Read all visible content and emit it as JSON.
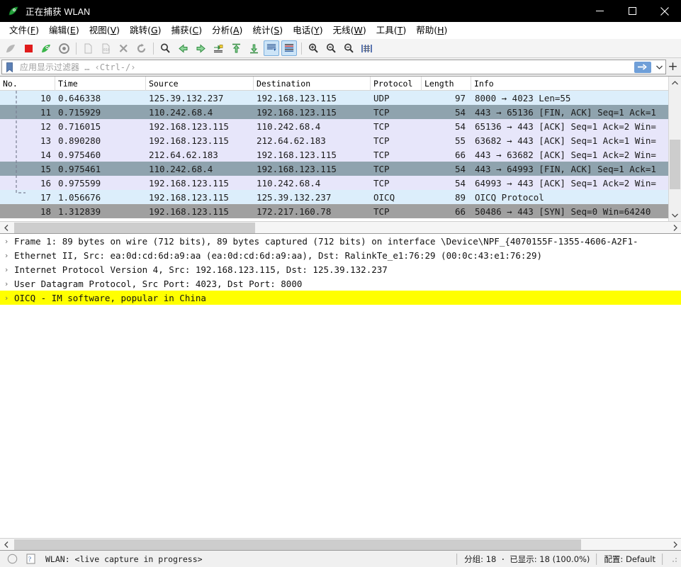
{
  "window": {
    "title": "正在捕获 WLAN",
    "app_icon": "wireshark-fin-icon",
    "controls": [
      {
        "name": "minimize-button",
        "glyph": "minimize-icon"
      },
      {
        "name": "maximize-button",
        "glyph": "maximize-icon"
      },
      {
        "name": "close-button",
        "glyph": "close-icon"
      }
    ]
  },
  "menubar": {
    "items": [
      {
        "label": "文件",
        "accel": "F"
      },
      {
        "label": "编辑",
        "accel": "E"
      },
      {
        "label": "视图",
        "accel": "V"
      },
      {
        "label": "跳转",
        "accel": "G"
      },
      {
        "label": "捕获",
        "accel": "C"
      },
      {
        "label": "分析",
        "accel": "A"
      },
      {
        "label": "统计",
        "accel": "S"
      },
      {
        "label": "电话",
        "accel": "Y"
      },
      {
        "label": "无线",
        "accel": "W"
      },
      {
        "label": "工具",
        "accel": "T"
      },
      {
        "label": "帮助",
        "accel": "H"
      }
    ]
  },
  "toolbar": {
    "buttons": [
      {
        "name": "start-capture-icon",
        "enabled": false,
        "active": false
      },
      {
        "name": "stop-capture-icon",
        "enabled": true,
        "active": false
      },
      {
        "name": "restart-capture-icon",
        "enabled": true,
        "active": false
      },
      {
        "name": "capture-options-icon",
        "enabled": true,
        "active": false
      },
      {
        "sep": true
      },
      {
        "name": "open-file-icon",
        "enabled": false,
        "active": false
      },
      {
        "name": "save-file-icon",
        "enabled": false,
        "active": false
      },
      {
        "name": "close-file-icon",
        "enabled": false,
        "active": false
      },
      {
        "name": "reload-file-icon",
        "enabled": false,
        "active": false
      },
      {
        "sep": true
      },
      {
        "name": "find-packet-icon",
        "enabled": true,
        "active": false
      },
      {
        "name": "go-back-icon",
        "enabled": true,
        "active": false
      },
      {
        "name": "go-forward-icon",
        "enabled": true,
        "active": false
      },
      {
        "name": "go-to-packet-icon",
        "enabled": true,
        "active": false
      },
      {
        "name": "go-to-first-packet-icon",
        "enabled": true,
        "active": false
      },
      {
        "name": "go-to-last-packet-icon",
        "enabled": true,
        "active": false
      },
      {
        "name": "auto-scroll-icon",
        "enabled": true,
        "active": true
      },
      {
        "name": "colorize-packets-icon",
        "enabled": true,
        "active": true
      },
      {
        "sep2": true
      },
      {
        "name": "zoom-in-icon",
        "enabled": true,
        "active": false
      },
      {
        "name": "zoom-out-icon",
        "enabled": true,
        "active": false
      },
      {
        "name": "zoom-reset-icon",
        "enabled": true,
        "active": false
      },
      {
        "name": "resize-columns-icon",
        "enabled": true,
        "active": false
      }
    ]
  },
  "filter": {
    "bookmark_icon": "filter-bookmark-icon",
    "value": "",
    "placeholder": "应用显示过滤器 … ‹Ctrl-/›",
    "apply_icon": "apply-filter-arrow-icon",
    "dropdown_icon": "chevron-down-icon",
    "add_icon": "add-filter-button"
  },
  "packet_list": {
    "columns": [
      {
        "key": "no",
        "label": "No."
      },
      {
        "key": "time",
        "label": "Time"
      },
      {
        "key": "source",
        "label": "Source"
      },
      {
        "key": "destination",
        "label": "Destination"
      },
      {
        "key": "protocol",
        "label": "Protocol"
      },
      {
        "key": "length",
        "label": "Length"
      },
      {
        "key": "info",
        "label": "Info"
      }
    ],
    "rows": [
      {
        "no": "10",
        "time": "0.646338",
        "source": "125.39.132.237",
        "destination": "192.168.123.115",
        "protocol": "UDP",
        "length": "97",
        "info": "8000 → 4023 Len=55",
        "style": "udp"
      },
      {
        "no": "11",
        "time": "0.715929",
        "source": "110.242.68.4",
        "destination": "192.168.123.115",
        "protocol": "TCP",
        "length": "54",
        "info": "443 → 65136 [FIN, ACK] Seq=1 Ack=1",
        "style": "gray"
      },
      {
        "no": "12",
        "time": "0.716015",
        "source": "192.168.123.115",
        "destination": "110.242.68.4",
        "protocol": "TCP",
        "length": "54",
        "info": "65136 → 443 [ACK] Seq=1 Ack=2 Win=",
        "style": "tcp"
      },
      {
        "no": "13",
        "time": "0.890280",
        "source": "192.168.123.115",
        "destination": "212.64.62.183",
        "protocol": "TCP",
        "length": "55",
        "info": "63682 → 443 [ACK] Seq=1 Ack=1 Win=",
        "style": "tcp"
      },
      {
        "no": "14",
        "time": "0.975460",
        "source": "212.64.62.183",
        "destination": "192.168.123.115",
        "protocol": "TCP",
        "length": "66",
        "info": "443 → 63682 [ACK] Seq=1 Ack=2 Win=",
        "style": "tcp"
      },
      {
        "no": "15",
        "time": "0.975461",
        "source": "110.242.68.4",
        "destination": "192.168.123.115",
        "protocol": "TCP",
        "length": "54",
        "info": "443 → 64993 [FIN, ACK] Seq=1 Ack=1",
        "style": "gray"
      },
      {
        "no": "16",
        "time": "0.975599",
        "source": "192.168.123.115",
        "destination": "110.242.68.4",
        "protocol": "TCP",
        "length": "54",
        "info": "64993 → 443 [ACK] Seq=1 Ack=2 Win=",
        "style": "tcp"
      },
      {
        "no": "17",
        "time": "1.056676",
        "source": "192.168.123.115",
        "destination": "125.39.132.237",
        "protocol": "OICQ",
        "length": "89",
        "info": "OICQ Protocol",
        "style": "udp"
      },
      {
        "no": "18",
        "time": "1.312839",
        "source": "192.168.123.115",
        "destination": "172.217.160.78",
        "protocol": "TCP",
        "length": "66",
        "info": "50486 → 443 [SYN] Seq=0 Win=64240",
        "style": "gray"
      }
    ]
  },
  "packet_detail": {
    "rows": [
      {
        "text": "Frame 1: 89 bytes on wire (712 bits), 89 bytes captured (712 bits) on interface \\Device\\NPF_{4070155F-1355-4606-A2F1-",
        "highlight": false
      },
      {
        "text": "Ethernet II, Src: ea:0d:cd:6d:a9:aa (ea:0d:cd:6d:a9:aa), Dst: RalinkTe_e1:76:29 (00:0c:43:e1:76:29)",
        "highlight": false
      },
      {
        "text": "Internet Protocol Version 4, Src: 192.168.123.115, Dst: 125.39.132.237",
        "highlight": false
      },
      {
        "text": "User Datagram Protocol, Src Port: 4023, Dst Port: 8000",
        "highlight": false
      },
      {
        "text": "OICQ - IM software, popular in China",
        "highlight": true
      }
    ]
  },
  "statusbar": {
    "expert_icon": "expert-info-icon",
    "help_icon": "capture-file-properties-icon",
    "capture_text": "WLAN: <live capture in progress>",
    "packets_label": "分组: 18",
    "separator_dot": "·",
    "displayed_label": "已显示: 18 (100.0%)",
    "profile_label": "配置: Default"
  },
  "colors": {
    "title_bar": "#000000",
    "udp_row": "#dceefb",
    "tcp_row": "#e7e6fa",
    "gray_row": "#a0a0a0",
    "gray_row_sel": "#8fa3ae",
    "highlight_yellow": "#ffff00",
    "accent_blue": "#6f9fd8"
  }
}
